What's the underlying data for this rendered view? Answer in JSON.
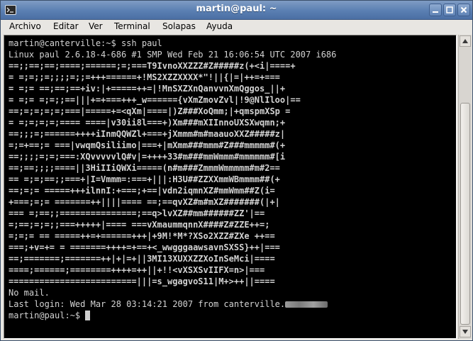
{
  "window": {
    "title": "martin@paul: ~"
  },
  "menu": {
    "items": [
      "Archivo",
      "Editar",
      "Ver",
      "Terminal",
      "Solapas",
      "Ayuda"
    ]
  },
  "terminal": {
    "lines": [
      "martin@canterville:~$ ssh paul",
      "Linux paul 2.6.18-4-686 #1 SMP Wed Feb 21 16:06:54 UTC 2007 i686",
      "==;;==;==;====;======;=;===T9IvnoXXZZZ#Z#####z(+<i|====+",
      "= =;=;;=;;;;=;;=+++======+!MS2XZZXXXX*\"!||{|=|++=+===",
      "= =;= ==;==;==+iv:|+=====++=|!MnSXZXnQanvvnXmQggos_||+",
      "= =;= =;=;;==|||+=+===+++_w======{vXmZmovZvl|!9@NlIloo|==",
      "==;=;=;=;=;===|=====+=<qXm|====|)Z###XoQmm;|+qmspmXSp =",
      "= =;=;=;=;==== ====|v30ii8l===+)Xm###mXIInnoUXSXwqmn;+",
      "==;;;=;======++++iInmQQWZl+===+jXmmm#m#maauoXXZ#####z|",
      "=;=+==;= ===|vwqmQsiliimo|===+|mXmm###mmm#Z###mmmmm#(+",
      "==;;;;=;=;===:XQvvvvvlQ#v|=++++33#m###mmWmmm#mmmmmm#[i",
      "==;==;;;;====||3HiIIiQWXi=====(n#m###ZmmmWmmmmm#m#2==",
      "== =;=;==;;===+|I=Vmmm=:===+|||:H3U##ZZXXmmWBmmmm##(+",
      "==;=;= =====+++ilnnI:+===;+==|vdn2iqmnXZ#mmWmm##Z(i=",
      "+===;=;= =======++||||==== ==;==qvXZ#m#mXZ#######(|+|",
      "=== =;==;;===============;==q>lvXZ##mm######ZZ'|==",
      "=;==;=;=;;===+++++|==== ===vXmaummqnnX####Z#ZZE++=;",
      "=;=;= == =====++=+======+++|+9M!*M*?XSo2XZZ#ZXe ++==",
      "===;+v=+= = =======++++=+==+<_wwgggaawsavnSXSS}++|===",
      "==;=======;=======++|+|=+||3MI13XUXXZZXoInSeMci|====",
      "====;======;========++++=++||+!!<vXSXSvIIFX=n>|===",
      "=========================|||=s_wgagvoS11|M+>++||====",
      "No mail.",
      "Last login: Wed Mar 28 03:14:21 2007 from canterville.",
      "martin@paul:~$ "
    ]
  }
}
